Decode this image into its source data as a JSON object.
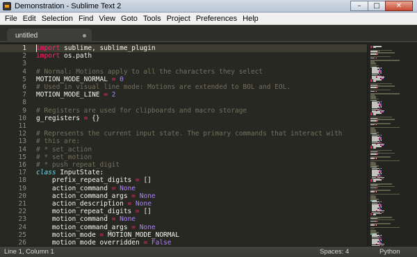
{
  "window": {
    "title": "Demonstration - Sublime Text 2",
    "controls": [
      "–",
      "□",
      "✕"
    ]
  },
  "menu": [
    "File",
    "Edit",
    "Selection",
    "Find",
    "View",
    "Goto",
    "Tools",
    "Project",
    "Preferences",
    "Help"
  ],
  "tab": {
    "label": "untitled",
    "dirty_indicator": "●"
  },
  "editor": {
    "active_line": 1,
    "lines": [
      [
        [
          "import",
          "kw"
        ],
        [
          " sublime, sublime_plugin",
          ""
        ]
      ],
      [
        [
          "import",
          "kw"
        ],
        [
          " os.path",
          ""
        ]
      ],
      [],
      [
        [
          "# Normal: Motions apply to all the characters they select",
          "cmt"
        ]
      ],
      [
        [
          "MOTION_MODE_NORMAL ",
          ""
        ],
        [
          "=",
          "kw"
        ],
        [
          " ",
          ""
        ],
        [
          "0",
          "num"
        ]
      ],
      [
        [
          "# Used in visual line mode: Motions are extended to BOL and EOL.",
          "cmt"
        ]
      ],
      [
        [
          "MOTION_MODE_LINE ",
          ""
        ],
        [
          "=",
          "kw"
        ],
        [
          " ",
          ""
        ],
        [
          "2",
          "num"
        ]
      ],
      [],
      [
        [
          "# Registers are used for clipboards and macro storage",
          "cmt"
        ]
      ],
      [
        [
          "g_registers ",
          ""
        ],
        [
          "=",
          "kw"
        ],
        [
          " {}",
          ""
        ]
      ],
      [],
      [
        [
          "# Represents the current input state. The primary commands that interact with",
          "cmt"
        ]
      ],
      [
        [
          "# this are:",
          "cmt"
        ]
      ],
      [
        [
          "# * set_action",
          "cmt"
        ]
      ],
      [
        [
          "# * set_motion",
          "cmt"
        ]
      ],
      [
        [
          "# * push_repeat_digit",
          "cmt"
        ]
      ],
      [
        [
          "class",
          "cls"
        ],
        [
          " InputState:",
          ""
        ]
      ],
      [
        [
          "    prefix_repeat_digits ",
          ""
        ],
        [
          "=",
          "kw"
        ],
        [
          " []",
          ""
        ]
      ],
      [
        [
          "    action_command ",
          ""
        ],
        [
          "=",
          "kw"
        ],
        [
          " ",
          ""
        ],
        [
          "None",
          "num"
        ]
      ],
      [
        [
          "    action_command_args ",
          ""
        ],
        [
          "=",
          "kw"
        ],
        [
          " ",
          ""
        ],
        [
          "None",
          "num"
        ]
      ],
      [
        [
          "    action_description ",
          ""
        ],
        [
          "=",
          "kw"
        ],
        [
          " ",
          ""
        ],
        [
          "None",
          "num"
        ]
      ],
      [
        [
          "    motion_repeat_digits ",
          ""
        ],
        [
          "=",
          "kw"
        ],
        [
          " []",
          ""
        ]
      ],
      [
        [
          "    motion_command ",
          ""
        ],
        [
          "=",
          "kw"
        ],
        [
          " ",
          ""
        ],
        [
          "None",
          "num"
        ]
      ],
      [
        [
          "    motion_command_args ",
          ""
        ],
        [
          "=",
          "kw"
        ],
        [
          " ",
          ""
        ],
        [
          "None",
          "num"
        ]
      ],
      [
        [
          "    motion_mode ",
          ""
        ],
        [
          "=",
          "kw"
        ],
        [
          " MOTION_MODE_NORMAL",
          ""
        ]
      ],
      [
        [
          "    motion_mode_overridden ",
          ""
        ],
        [
          "=",
          "kw"
        ],
        [
          " ",
          ""
        ],
        [
          "False",
          "num"
        ]
      ]
    ]
  },
  "syntax_colors": {
    "background": "#272822",
    "keyword": "#f92672",
    "comment": "#75715e",
    "constant": "#ae81ff",
    "class": "#66d9ef",
    "text": "#f8f8f2"
  },
  "status": {
    "position": "Line 1, Column 1",
    "spaces": "Spaces: 4",
    "syntax": "Python"
  }
}
